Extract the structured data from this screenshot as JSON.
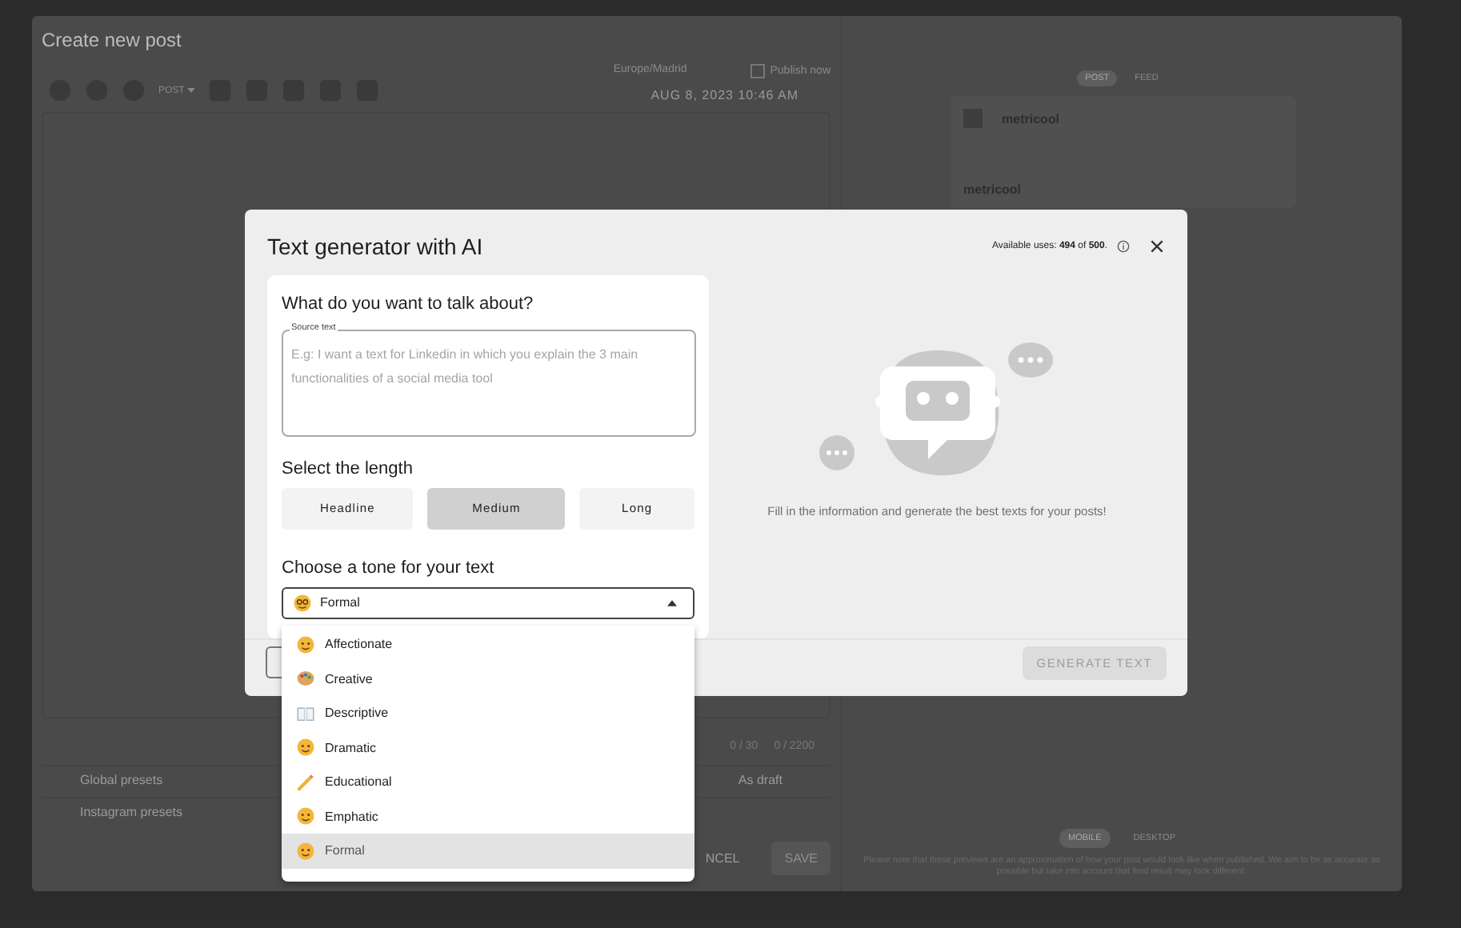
{
  "post_editor": {
    "title": "Create new post",
    "post_type": "POST",
    "timezone": "Europe/Madrid",
    "publish_now": {
      "label": "Publish now",
      "checked": false
    },
    "date": "AUG 8, 2023 10:46 AM",
    "counters": [
      "0 / 30",
      "0 / 2200"
    ],
    "presets": [
      {
        "label": "Global presets"
      },
      {
        "label": "Instagram presets"
      }
    ],
    "draft_label": "As draft",
    "cancel": "NCEL",
    "save": "SAVE"
  },
  "preview": {
    "tabs": [
      {
        "label": "POST",
        "selected": true
      },
      {
        "label": "FEED",
        "selected": false
      }
    ],
    "account": "metricool",
    "caption_account": "metricool",
    "devices": [
      {
        "label": "MOBILE",
        "selected": true
      },
      {
        "label": "DESKTOP",
        "selected": false
      }
    ],
    "note": "Please note that these previews are an approximation of how your post would look like when published. We aim to be as accurate as possible but take into account that final result may look different."
  },
  "dialog": {
    "title": "Text generator with AI",
    "uses": "Available uses: **494** of **500**.",
    "topic": {
      "heading": "What do you want to talk about?",
      "field_label": "Source text",
      "placeholder": "E.g: I want a text for Linkedin in which you explain the 3 main functionalities of a social media tool"
    },
    "length": {
      "heading": "Select the length",
      "options": [
        {
          "label": "Headline",
          "selected": false
        },
        {
          "label": "Medium",
          "selected": true
        },
        {
          "label": "Long",
          "selected": false
        }
      ]
    },
    "tone": {
      "heading": "Choose a tone for your text",
      "value": "Formal",
      "expanded": true,
      "options": [
        {
          "label": "Affectionate",
          "selected": false
        },
        {
          "label": "Creative",
          "selected": false
        },
        {
          "label": "Descriptive",
          "selected": false
        },
        {
          "label": "Dramatic",
          "selected": false
        },
        {
          "label": "Educational",
          "selected": false
        },
        {
          "label": "Emphatic",
          "selected": false
        },
        {
          "label": "Formal",
          "selected": true
        }
      ]
    },
    "empty_message": "Fill in the information and generate the best texts for your posts!",
    "generate": {
      "label": "GENERATE TEXT",
      "disabled": true
    }
  }
}
